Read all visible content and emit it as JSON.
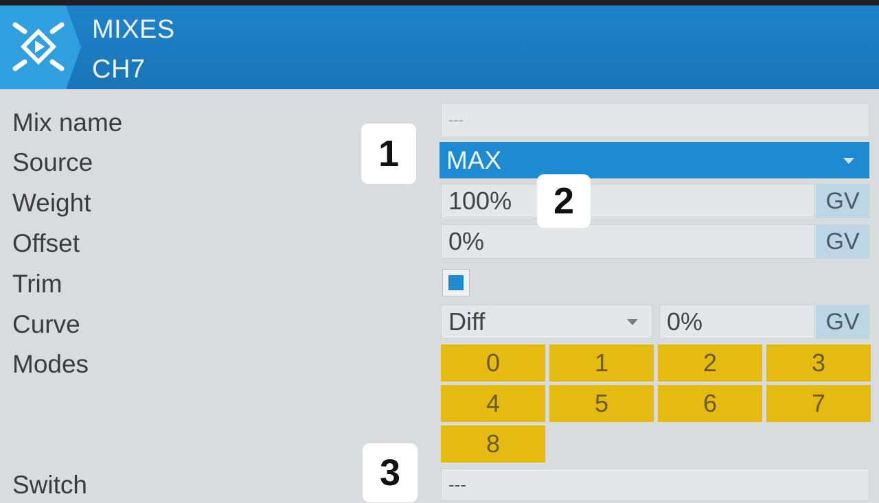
{
  "header": {
    "title": "MIXES",
    "subtitle": "CH7"
  },
  "labels": {
    "mix_name": "Mix name",
    "source": "Source",
    "weight": "Weight",
    "offset": "Offset",
    "trim": "Trim",
    "curve": "Curve",
    "modes": "Modes",
    "switch": "Switch"
  },
  "fields": {
    "mix_name_value": "---",
    "source_value": "MAX",
    "weight_value": "100%",
    "offset_value": "0%",
    "trim_checked": true,
    "curve_type": "Diff",
    "curve_value": "0%",
    "switch_value": "---",
    "gv_label": "GV"
  },
  "modes": [
    "0",
    "1",
    "2",
    "3",
    "4",
    "5",
    "6",
    "7",
    "8"
  ],
  "annotations": {
    "badge1": "1",
    "badge2": "2",
    "badge3": "3"
  },
  "colors": {
    "header": "#1a74b8",
    "accent": "#1e8ad2",
    "mode": "#e5bb12"
  }
}
